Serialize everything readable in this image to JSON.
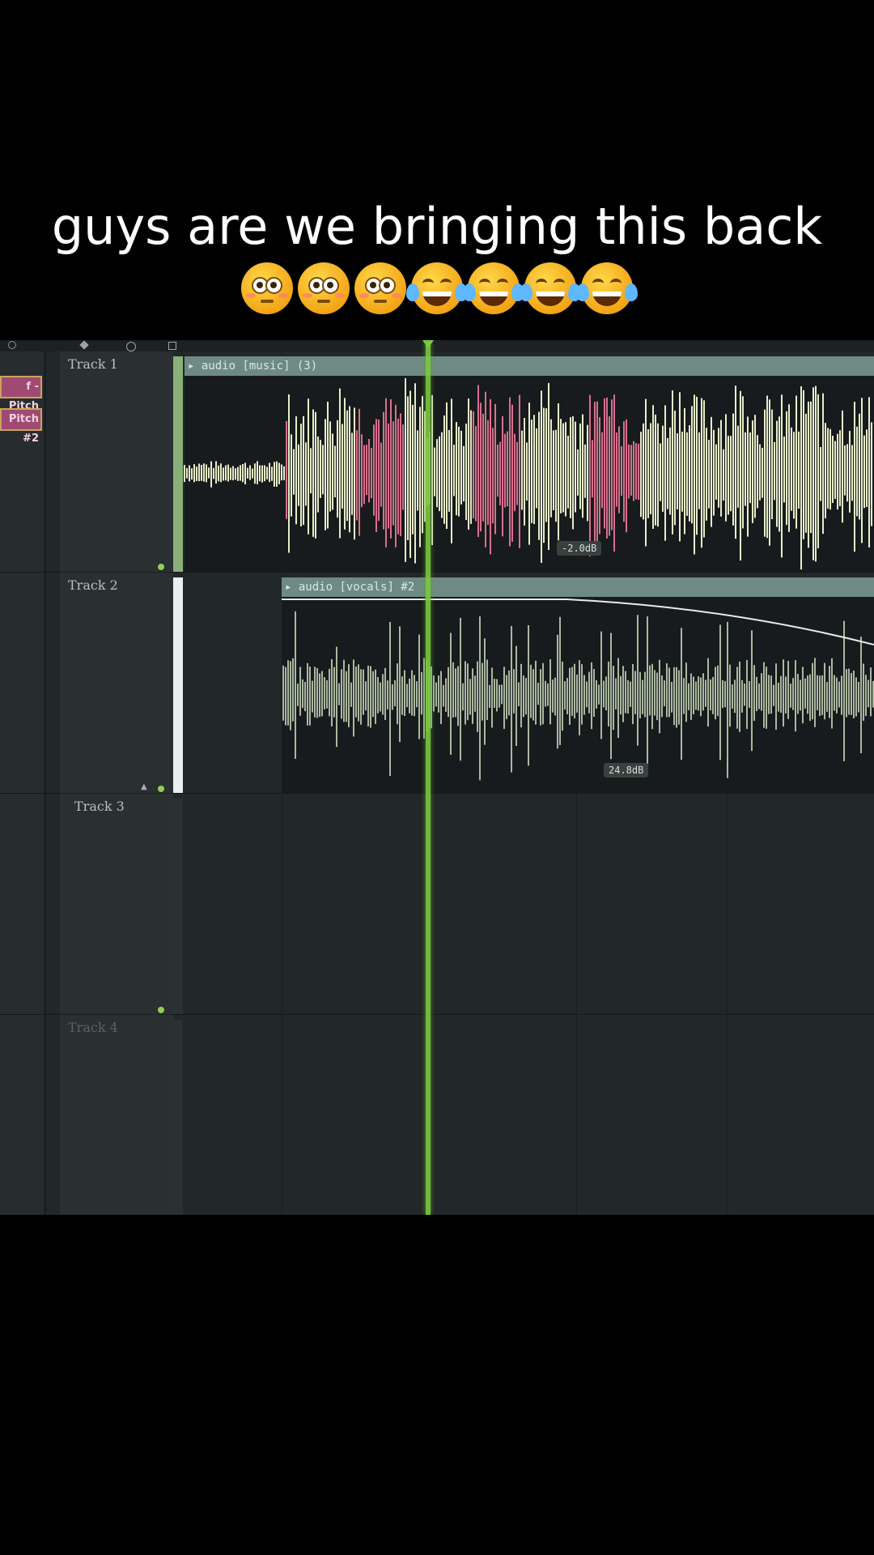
{
  "caption": {
    "line1": "guys are we bringing this back",
    "emojis": [
      "flushed-face",
      "flushed-face",
      "flushed-face",
      "face-with-tears-of-joy",
      "face-with-tears-of-joy",
      "face-with-tears-of-joy",
      "face-with-tears-of-joy"
    ]
  },
  "left_panel": {
    "tags": [
      "f - Pitch",
      "Pitch #2"
    ]
  },
  "tracks": [
    {
      "label": "Track 1",
      "clip_title": "audio [music] (3)",
      "volume_badge": "-2.0dB"
    },
    {
      "label": "Track 2",
      "clip_title": "audio [vocals] #2",
      "volume_badge": "24.8dB"
    },
    {
      "label": "Track 3"
    },
    {
      "label": "Track 4"
    }
  ],
  "colors": {
    "playhead": "#7ac93f",
    "waveform_light": "#e8edc9",
    "waveform_pink": "#d9708e",
    "waveform_vocal": "#cfe0c2",
    "clip_header": "#6f8a84",
    "track_bg": "#22272a"
  }
}
